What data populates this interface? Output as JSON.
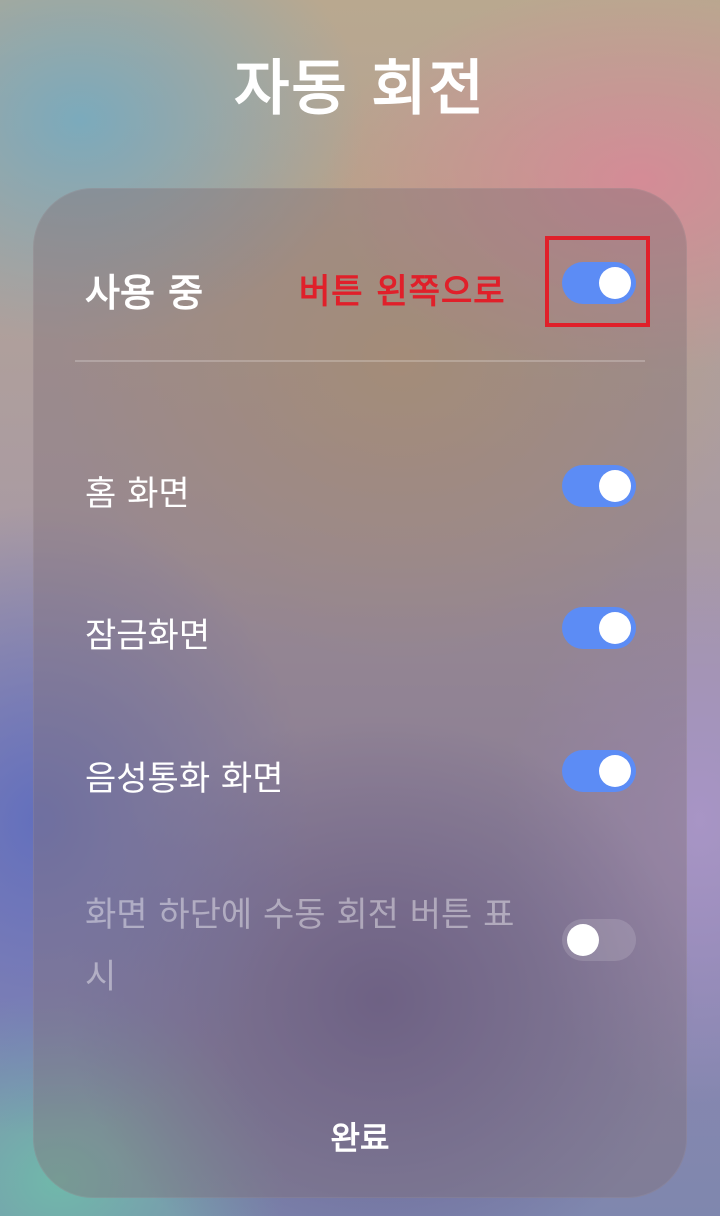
{
  "title": "자동 회전",
  "annotation": {
    "text": "버튼 왼쪽으로",
    "color": "#e0202a"
  },
  "settings": [
    {
      "label": "사용 중",
      "enabled": true,
      "disabled": false
    },
    {
      "label": "홈 화면",
      "enabled": true,
      "disabled": false
    },
    {
      "label": "잠금화면",
      "enabled": true,
      "disabled": false
    },
    {
      "label": "음성통화 화면",
      "enabled": true,
      "disabled": false
    },
    {
      "label": "화면 하단에 수동 회전 버튼 표시",
      "enabled": false,
      "disabled": true
    }
  ],
  "done_label": "완료",
  "colors": {
    "toggle_on": "#5c8cf5",
    "toggle_knob": "#ffffff"
  }
}
